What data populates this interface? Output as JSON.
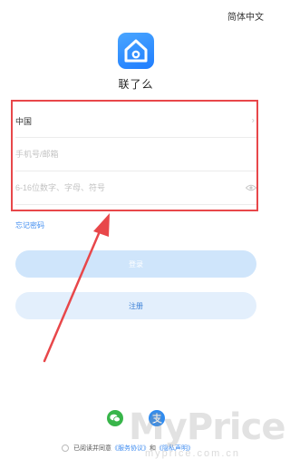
{
  "header": {
    "language_switch": "简体中文"
  },
  "app": {
    "name": "联了么",
    "logo_icon": "house-icon"
  },
  "form": {
    "region": "中国",
    "phone_placeholder": "手机号/邮箱",
    "password_placeholder": "6-16位数字、字母、符号"
  },
  "links": {
    "forgot_password": "忘记密码"
  },
  "buttons": {
    "login": "登录",
    "register": "注册"
  },
  "social": {
    "wechat_icon": "wechat-icon",
    "alipay_icon": "alipay-icon"
  },
  "agreement": {
    "prefix": "已阅读并同意",
    "service": "《服务协议》",
    "conjunction": "和",
    "privacy": "《隐私声明》"
  },
  "watermark": {
    "brand": "MyPrice",
    "url": "myprice.com.cn"
  },
  "colors": {
    "accent": "#3f8cf0",
    "annotation": "#e8474a"
  }
}
